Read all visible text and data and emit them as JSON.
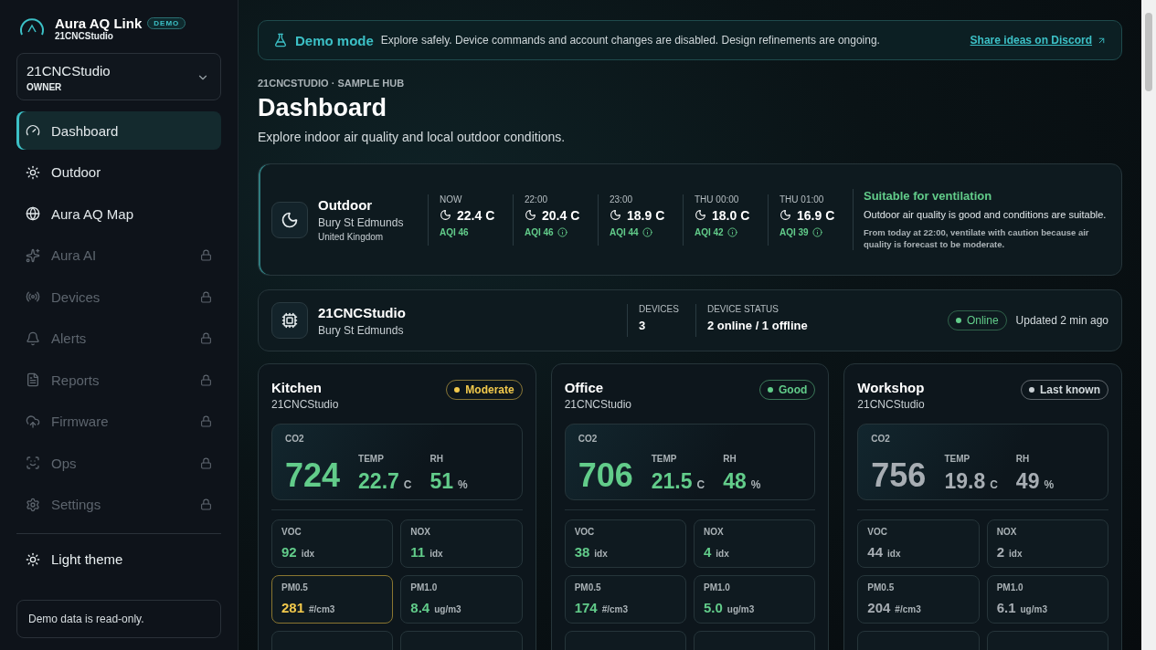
{
  "app": {
    "name": "Aura AQ Link",
    "badge": "DEMO",
    "org": "21CNCStudio"
  },
  "workspace": {
    "name": "21CNCStudio",
    "role": "OWNER"
  },
  "nav": [
    {
      "label": "Dashboard",
      "selected": true,
      "locked": false
    },
    {
      "label": "Outdoor",
      "selected": false,
      "locked": false
    },
    {
      "label": "Aura AQ Map",
      "selected": false,
      "locked": false
    },
    {
      "label": "Aura AI",
      "selected": false,
      "locked": true
    },
    {
      "label": "Devices",
      "selected": false,
      "locked": true
    },
    {
      "label": "Alerts",
      "selected": false,
      "locked": true
    },
    {
      "label": "Reports",
      "selected": false,
      "locked": true
    },
    {
      "label": "Firmware",
      "selected": false,
      "locked": true
    },
    {
      "label": "Ops",
      "selected": false,
      "locked": true
    },
    {
      "label": "Settings",
      "selected": false,
      "locked": true
    }
  ],
  "theme_toggle": "Light theme",
  "sidebar_note": "Demo data is read-only.",
  "banner": {
    "title": "Demo mode",
    "text": "Explore safely. Device commands and account changes are disabled. Design refinements are ongoing.",
    "link": "Share ideas on Discord"
  },
  "eyebrow": "21CNCSTUDIO · SAMPLE HUB",
  "title": "Dashboard",
  "subtitle": "Explore indoor air quality and local outdoor conditions.",
  "outdoor": {
    "title": "Outdoor",
    "location": "Bury St Edmunds",
    "country": "United Kingdom",
    "forecast": [
      {
        "time": "NOW",
        "temp": "22.4 C",
        "aqi": "AQI 46",
        "info": false
      },
      {
        "time": "22:00",
        "temp": "20.4 C",
        "aqi": "AQI 46",
        "info": true
      },
      {
        "time": "23:00",
        "temp": "18.9 C",
        "aqi": "AQI 44",
        "info": true
      },
      {
        "time": "THU 00:00",
        "temp": "18.0 C",
        "aqi": "AQI 42",
        "info": true
      },
      {
        "time": "THU 01:00",
        "temp": "16.9 C",
        "aqi": "AQI 39",
        "info": true
      }
    ],
    "advice": {
      "title": "Suitable for ventilation",
      "text": "Outdoor air quality is good and conditions are suitable.",
      "note": "From today at 22:00, ventilate with caution because air quality is forecast to be moderate."
    }
  },
  "hub": {
    "name": "21CNCStudio",
    "location": "Bury St Edmunds",
    "stats": [
      {
        "label": "DEVICES",
        "value": "3"
      },
      {
        "label": "DEVICE STATUS",
        "value": "2 online / 1 offline"
      }
    ],
    "status": {
      "label": "Online",
      "online": true
    },
    "updated": "Updated 2 min ago"
  },
  "rooms": [
    {
      "name": "Kitchen",
      "hub": "21CNCStudio",
      "status": {
        "kind": "moderate",
        "label": "Moderate"
      },
      "co2": {
        "label": "CO2",
        "value": "724"
      },
      "readings": [
        {
          "label": "TEMP",
          "value": "22.7",
          "unit": "C"
        },
        {
          "label": "RH",
          "value": "51",
          "unit": "%"
        }
      ],
      "metrics": [
        {
          "label": "VOC",
          "value": "92",
          "unit": "idx",
          "alert": false
        },
        {
          "label": "NOX",
          "value": "11",
          "unit": "idx",
          "alert": false
        },
        {
          "label": "PM0.5",
          "value": "281",
          "unit": "#/cm3",
          "alert": true
        },
        {
          "label": "PM1.0",
          "value": "8.4",
          "unit": "ug/m3",
          "alert": false
        }
      ]
    },
    {
      "name": "Office",
      "hub": "21CNCStudio",
      "status": {
        "kind": "good",
        "label": "Good"
      },
      "co2": {
        "label": "CO2",
        "value": "706"
      },
      "readings": [
        {
          "label": "TEMP",
          "value": "21.5",
          "unit": "C"
        },
        {
          "label": "RH",
          "value": "48",
          "unit": "%"
        }
      ],
      "metrics": [
        {
          "label": "VOC",
          "value": "38",
          "unit": "idx",
          "alert": false
        },
        {
          "label": "NOX",
          "value": "4",
          "unit": "idx",
          "alert": false
        },
        {
          "label": "PM0.5",
          "value": "174",
          "unit": "#/cm3",
          "alert": false
        },
        {
          "label": "PM1.0",
          "value": "5.0",
          "unit": "ug/m3",
          "alert": false
        }
      ]
    },
    {
      "name": "Workshop",
      "hub": "21CNCStudio",
      "status": {
        "kind": "stale",
        "label": "Last known"
      },
      "co2": {
        "label": "CO2",
        "value": "756"
      },
      "readings": [
        {
          "label": "TEMP",
          "value": "19.8",
          "unit": "C"
        },
        {
          "label": "RH",
          "value": "49",
          "unit": "%"
        }
      ],
      "metrics": [
        {
          "label": "VOC",
          "value": "44",
          "unit": "idx",
          "alert": false
        },
        {
          "label": "NOX",
          "value": "2",
          "unit": "idx",
          "alert": false
        },
        {
          "label": "PM0.5",
          "value": "204",
          "unit": "#/cm3",
          "alert": false
        },
        {
          "label": "PM1.0",
          "value": "6.1",
          "unit": "ug/m3",
          "alert": false
        }
      ]
    }
  ]
}
